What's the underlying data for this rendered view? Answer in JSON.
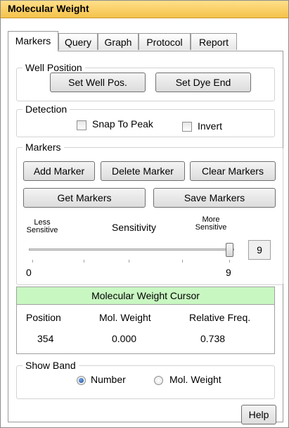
{
  "window": {
    "title": "Molecular Weight"
  },
  "tabs": [
    {
      "label": "Markers",
      "active": true
    },
    {
      "label": "Query",
      "active": false
    },
    {
      "label": "Graph",
      "active": false
    },
    {
      "label": "Protocol",
      "active": false
    },
    {
      "label": "Report",
      "active": false
    }
  ],
  "well_position": {
    "legend": "Well Position",
    "set_well_pos_label": "Set Well Pos.",
    "set_dye_end_label": "Set Dye End"
  },
  "detection": {
    "legend": "Detection",
    "snap_to_peak_label": "Snap To Peak",
    "snap_to_peak_checked": false,
    "invert_label": "Invert",
    "invert_checked": false
  },
  "markers": {
    "legend": "Markers",
    "add_marker_label": "Add Marker",
    "delete_marker_label": "Delete Marker",
    "clear_markers_label": "Clear Markers",
    "get_markers_label": "Get Markers",
    "save_markers_label": "Save Markers",
    "less_sensitive_label": "Less Sensitive",
    "sensitivity_label": "Sensitivity",
    "more_sensitive_label": "More Sensitive",
    "slider_min": "0",
    "slider_max": "9",
    "slider_value": "9"
  },
  "cursor": {
    "title": "Molecular Weight Cursor",
    "columns": [
      "Position",
      "Mol. Weight",
      "Relative Freq."
    ],
    "values": [
      "354",
      "0.000",
      "0.738"
    ],
    "header_color": "#c9f7c2"
  },
  "show_band": {
    "legend": "Show Band",
    "options": [
      {
        "label": "Number",
        "selected": true
      },
      {
        "label": "Mol. Weight",
        "selected": false
      }
    ]
  },
  "help_label": "Help"
}
